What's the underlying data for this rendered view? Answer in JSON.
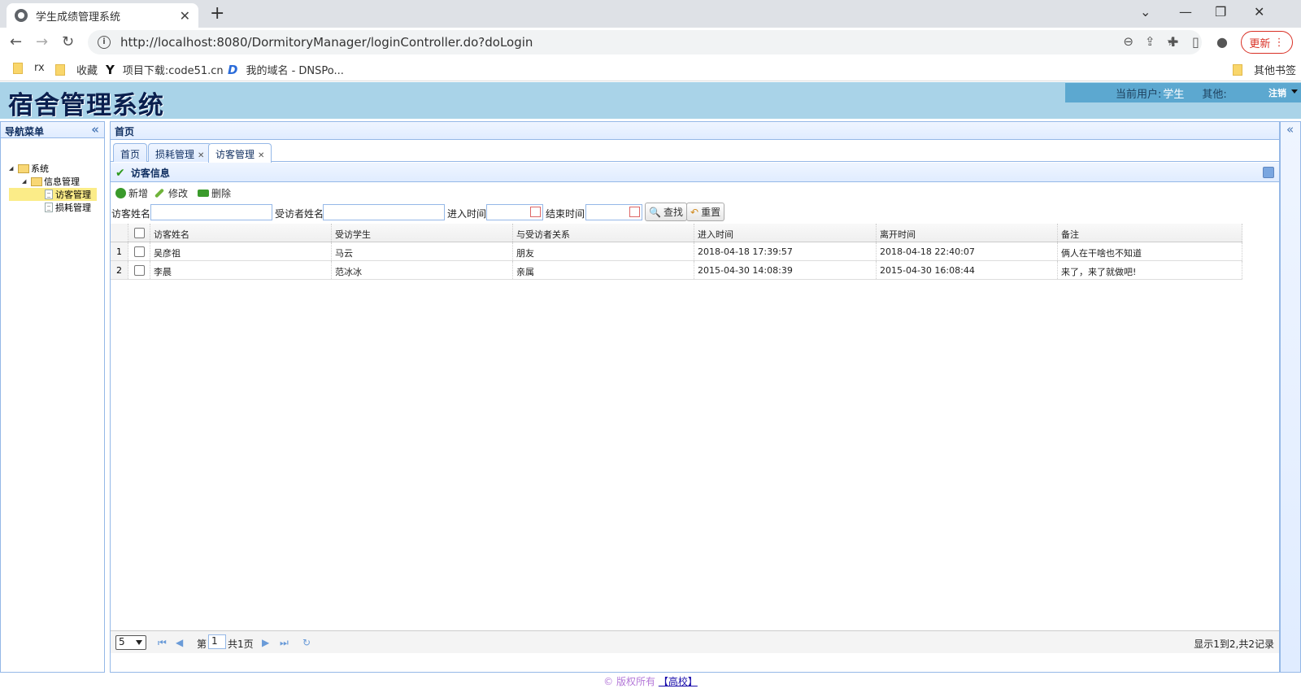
{
  "browser": {
    "tab_title": "学生成绩管理系统",
    "tab_close": "✕",
    "new_tab": "+",
    "url": "http://localhost:8080/DormitoryManager/loginController.do?doLogin",
    "update_label": "更新",
    "bookmarks": [
      "rx",
      "收藏",
      "项目下载:code51.cn",
      "我的域名 - DNSPo..."
    ],
    "other_bookmarks": "其他书签"
  },
  "header": {
    "logo": "宿舍管理系统",
    "current_user_label": "当前用户:",
    "current_user": "学生",
    "other_label": "其他:",
    "logout": "注销"
  },
  "west": {
    "title": "导航菜单",
    "tree": {
      "root": "系统",
      "group": "信息管理",
      "items": [
        "访客管理",
        "损耗管理"
      ]
    }
  },
  "center": {
    "title": "首页",
    "tabs": [
      "首页",
      "损耗管理",
      "访客管理"
    ],
    "panel_title": "访客信息",
    "toolbar": {
      "add": "新增",
      "edit": "修改",
      "delete": "删除"
    },
    "search": {
      "visitor_name_label": "访客姓名:",
      "visited_name_label": "受访者姓名:",
      "enter_time_label": "进入时间:",
      "end_time_label": "结束时间:",
      "find_btn": "查找",
      "reset_btn": "重置"
    },
    "grid": {
      "columns": [
        "访客姓名",
        "受访学生",
        "与受访者关系",
        "进入时间",
        "离开时间",
        "备注"
      ],
      "rows": [
        {
          "num": "1",
          "cells": [
            "吴彦祖",
            "马云",
            "朋友",
            "2018-04-18 17:39:57",
            "2018-04-18 22:40:07",
            "俩人在干啥也不知道"
          ]
        },
        {
          "num": "2",
          "cells": [
            "李晨",
            "范冰冰",
            "亲属",
            "2015-04-30 14:08:39",
            "2015-04-30 16:08:44",
            "来了，来了就做吧!"
          ]
        }
      ]
    },
    "pager": {
      "page_size": "5",
      "page_prefix": "第",
      "page_num": "1",
      "page_total": "共1页",
      "info": "显示1到2,共2记录"
    }
  },
  "footer": {
    "text": "© 版权所有",
    "link": "【高校】"
  },
  "colors": {
    "accent": "#95b8e7",
    "header_bg": "#a9d3e8",
    "selected": "#fbec88"
  }
}
